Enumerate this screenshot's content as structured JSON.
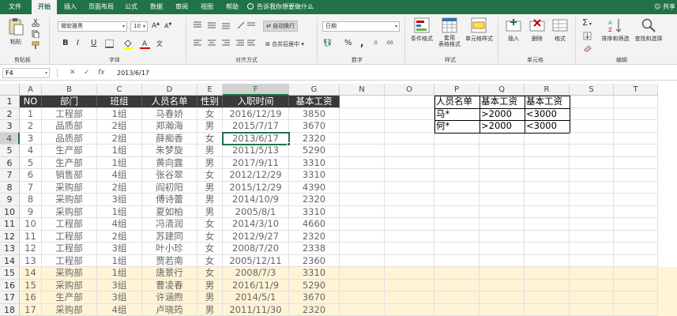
{
  "tabs": [
    "文件",
    "开始",
    "插入",
    "页面布局",
    "公式",
    "数据",
    "审阅",
    "视图",
    "帮助"
  ],
  "active_tab": "开始",
  "tell_me": "告诉我你想要做什么",
  "share_label": "共享",
  "ribbon": {
    "clipboard": {
      "label": "剪贴板",
      "paste": "粘贴"
    },
    "font": {
      "label": "字体",
      "name": "微软雅黑",
      "size": "10",
      "bold": "B",
      "italic": "I",
      "underline": "U",
      "grow": "A",
      "shrink": "A"
    },
    "alignment": {
      "label": "对齐方式",
      "wrap": "自动换行",
      "merge": "合并后居中"
    },
    "number": {
      "label": "数字",
      "format": "日期",
      "percent": "%",
      "comma": ",",
      "inc_dec": ".0",
      "dec_dec": ".00"
    },
    "styles": {
      "label": "样式",
      "conditional": "条件格式",
      "table": "套用\n表格格式",
      "cell_styles": "单元格样式"
    },
    "cells": {
      "label": "单元格",
      "insert": "插入",
      "delete": "删除",
      "format": "格式"
    },
    "editing": {
      "label": "编辑",
      "sort": "排序和筛选",
      "find": "查找和选择"
    }
  },
  "formula_bar": {
    "name_box": "F4",
    "cancel": "✕",
    "enter": "✓",
    "fx": "fx",
    "content": "2013/6/17"
  },
  "columns": [
    "A",
    "B",
    "C",
    "D",
    "E",
    "F",
    "G",
    "N",
    "O",
    "P",
    "Q",
    "R",
    "S",
    "T"
  ],
  "selected_column": "F",
  "row_numbers": [
    "1",
    "2",
    "3",
    "4",
    "5",
    "6",
    "7",
    "8",
    "9",
    "10",
    "11",
    "12",
    "13",
    "14",
    "15",
    "16",
    "17",
    "18"
  ],
  "selected_row": "4",
  "table_header": [
    "NO",
    "部门",
    "班组",
    "人员名单",
    "性别",
    "入职时间",
    "基本工资"
  ],
  "table_rows": [
    [
      "1",
      "工程部",
      "1组",
      "马春娇",
      "女",
      "2016/12/19",
      "3850"
    ],
    [
      "2",
      "品质部",
      "2组",
      "郑瀚海",
      "男",
      "2015/7/17",
      "3670"
    ],
    [
      "3",
      "品质部",
      "2组",
      "薛痴香",
      "女",
      "2013/6/17",
      "2320"
    ],
    [
      "4",
      "生产部",
      "1组",
      "朱梦旋",
      "男",
      "2011/5/13",
      "5290"
    ],
    [
      "5",
      "生产部",
      "1组",
      "黄向露",
      "男",
      "2017/9/11",
      "3310"
    ],
    [
      "6",
      "销售部",
      "4组",
      "张谷翠",
      "女",
      "2012/12/29",
      "3310"
    ],
    [
      "7",
      "采购部",
      "2组",
      "阎初阳",
      "男",
      "2015/12/29",
      "4390"
    ],
    [
      "8",
      "采购部",
      "3组",
      "傅诗蕾",
      "男",
      "2014/10/9",
      "2320"
    ],
    [
      "9",
      "采购部",
      "1组",
      "夏如柏",
      "男",
      "2005/8/1",
      "3310"
    ],
    [
      "10",
      "工程部",
      "4组",
      "冯清润",
      "女",
      "2014/3/10",
      "4660"
    ],
    [
      "11",
      "工程部",
      "2组",
      "苏建同",
      "女",
      "2012/9/27",
      "2320"
    ],
    [
      "12",
      "工程部",
      "3组",
      "叶小珍",
      "女",
      "2008/7/20",
      "2338"
    ],
    [
      "13",
      "工程部",
      "1组",
      "贾若南",
      "女",
      "2005/12/11",
      "2360"
    ],
    [
      "14",
      "采购部",
      "1组",
      "唐景行",
      "女",
      "2008/7/3",
      "3310"
    ],
    [
      "15",
      "采购部",
      "3组",
      "曹凌春",
      "男",
      "2016/11/9",
      "5290"
    ],
    [
      "16",
      "生产部",
      "3组",
      "许涵煦",
      "男",
      "2014/5/1",
      "3670"
    ],
    [
      "17",
      "采购部",
      "4组",
      "卢晓筠",
      "男",
      "2011/11/30",
      "2320"
    ]
  ],
  "criteria_header": [
    "人员名单",
    "基本工资",
    "基本工资"
  ],
  "criteria_rows": [
    [
      "马*",
      ">2000",
      "<3000"
    ],
    [
      "何*",
      ">2000",
      "<3000"
    ]
  ],
  "highlight_color": "#fff4d6",
  "accent_color": "#217346"
}
